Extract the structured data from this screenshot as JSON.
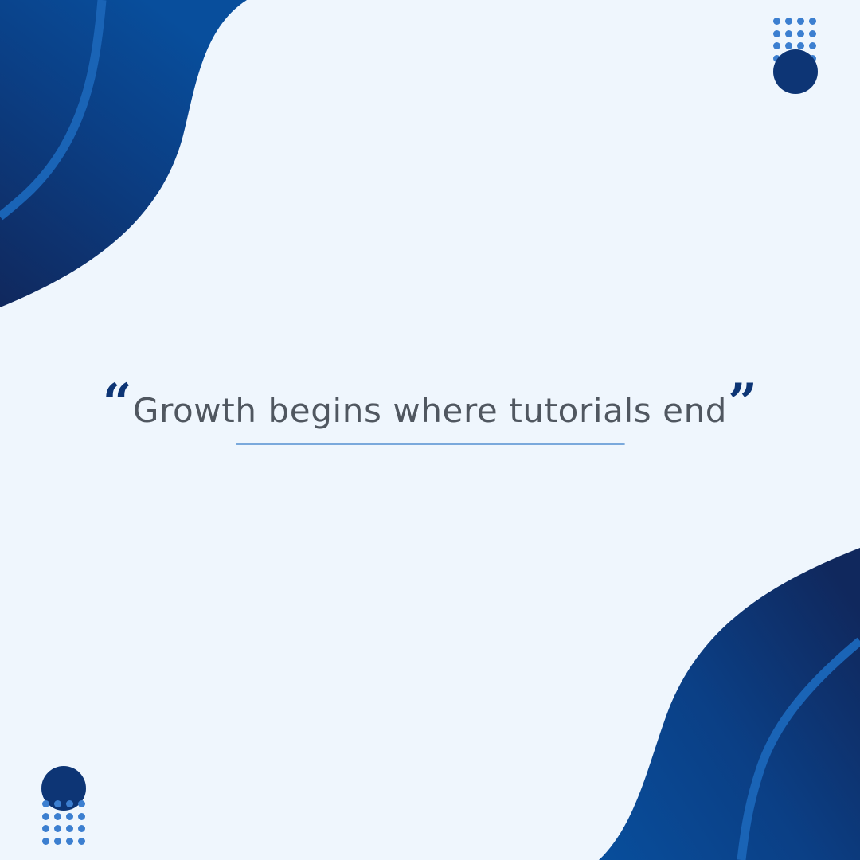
{
  "quote": {
    "open_mark": "“",
    "text": "Growth begins where tutorials end",
    "close_mark": "”"
  },
  "colors": {
    "background": "#eff6fd",
    "navy_dark": "#10285d",
    "navy_mid": "#0b3f85",
    "navy_light": "#084e9c",
    "accent_stripe": "#1a64b6",
    "dots": "#3c7fd0",
    "circle": "#0d3575",
    "quote_text": "#505760",
    "quote_marks": "#0d3575",
    "underline": "#7aa9dc"
  },
  "decor": {
    "top_left": "wave-shape",
    "bottom_right": "wave-shape",
    "top_right": "dot-grid-with-circle",
    "bottom_left": "dot-grid-with-circle"
  }
}
